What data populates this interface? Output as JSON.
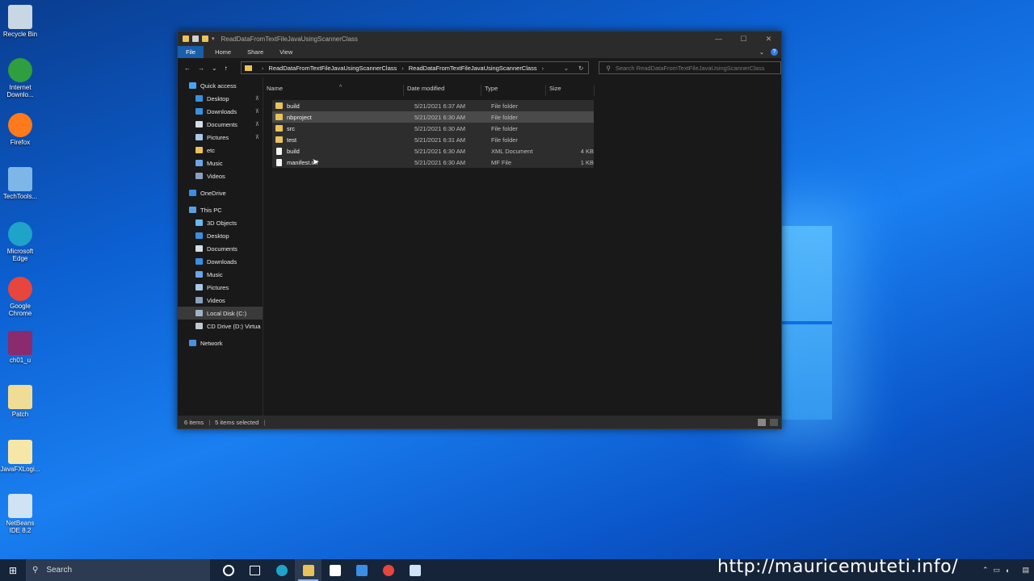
{
  "desktop": {
    "icons": [
      {
        "label": "Recycle Bin",
        "icon": "recycle-bin-icon",
        "color": "#c9d6e3"
      },
      {
        "label": "Internet Downlo...",
        "icon": "download-manager-icon",
        "color": "#2e9e3e"
      },
      {
        "label": "Firefox",
        "icon": "firefox-icon",
        "color": "#ff7a1a"
      },
      {
        "label": "TechTools...",
        "icon": "folder-shortcut-icon",
        "color": "#7fb6e8"
      },
      {
        "label": "Microsoft Edge",
        "icon": "edge-icon",
        "color": "#1fa3c8"
      },
      {
        "label": "Google Chrome",
        "icon": "chrome-icon",
        "color": "#e8453c"
      },
      {
        "label": "ch01_u",
        "icon": "winrar-icon",
        "color": "#8a2b6e"
      },
      {
        "label": "Patch",
        "icon": "folder-icon",
        "color": "#f1dc96"
      },
      {
        "label": "JavaFXLogi...",
        "icon": "java-file-icon",
        "color": "#f6e7a8"
      },
      {
        "label": "NetBeans IDE 8.2",
        "icon": "netbeans-icon",
        "color": "#cfe3f5"
      }
    ]
  },
  "window": {
    "title": "ReadDataFromTextFileJavaUsingScannerClass",
    "controls": {
      "minimize": "—",
      "maximize": "☐",
      "close": "✕"
    },
    "ribbon_tabs": [
      "File",
      "Home",
      "Share",
      "View"
    ],
    "help": "?",
    "address": {
      "segments": [
        "ReadDataFromTextFileJavaUsingScannerClass",
        "ReadDataFromTextFileJavaUsingScannerClass"
      ],
      "separator": "›"
    },
    "search_placeholder": "Search ReadDataFromTextFileJavaUsingScannerClass",
    "sidebar": [
      {
        "label": "Quick access",
        "icon": "star-icon",
        "color": "#4aa3f0",
        "indent": 14,
        "pinned": false
      },
      {
        "label": "Desktop",
        "icon": "desktop-icon",
        "color": "#3b8fe0",
        "indent": 22,
        "pinned": true
      },
      {
        "label": "Downloads",
        "icon": "download-arrow-icon",
        "color": "#3b8fe0",
        "indent": 22,
        "pinned": true
      },
      {
        "label": "Documents",
        "icon": "documents-icon",
        "color": "#d7dde6",
        "indent": 22,
        "pinned": true
      },
      {
        "label": "Pictures",
        "icon": "pictures-icon",
        "color": "#a9c8e8",
        "indent": 22,
        "pinned": true
      },
      {
        "label": "etc",
        "icon": "folder-icon",
        "color": "#e9c25c",
        "indent": 22,
        "pinned": false
      },
      {
        "label": "Music",
        "icon": "music-icon",
        "color": "#6aa6e8",
        "indent": 22,
        "pinned": false
      },
      {
        "label": "Videos",
        "icon": "videos-icon",
        "color": "#8aa0c0",
        "indent": 22,
        "pinned": false
      },
      {
        "label": "",
        "icon": "",
        "color": "",
        "indent": 0,
        "pinned": false,
        "spacer": true
      },
      {
        "label": "OneDrive",
        "icon": "onedrive-icon",
        "color": "#3a8ee6",
        "indent": 14,
        "pinned": false
      },
      {
        "label": "",
        "icon": "",
        "color": "",
        "indent": 0,
        "pinned": false,
        "spacer": true
      },
      {
        "label": "This PC",
        "icon": "computer-icon",
        "color": "#5aa0e0",
        "indent": 14,
        "pinned": false
      },
      {
        "label": "3D Objects",
        "icon": "3d-objects-icon",
        "color": "#6ab8f0",
        "indent": 22,
        "pinned": false
      },
      {
        "label": "Desktop",
        "icon": "desktop-icon",
        "color": "#3b8fe0",
        "indent": 22,
        "pinned": false
      },
      {
        "label": "Documents",
        "icon": "documents-icon",
        "color": "#d7dde6",
        "indent": 22,
        "pinned": false
      },
      {
        "label": "Downloads",
        "icon": "download-arrow-icon",
        "color": "#3b8fe0",
        "indent": 22,
        "pinned": false
      },
      {
        "label": "Music",
        "icon": "music-icon",
        "color": "#6aa6e8",
        "indent": 22,
        "pinned": false
      },
      {
        "label": "Pictures",
        "icon": "pictures-icon",
        "color": "#a9c8e8",
        "indent": 22,
        "pinned": false
      },
      {
        "label": "Videos",
        "icon": "videos-icon",
        "color": "#8aa0c0",
        "indent": 22,
        "pinned": false
      },
      {
        "label": "Local Disk (C:)",
        "icon": "disk-icon",
        "color": "#9fb4c8",
        "indent": 22,
        "pinned": false,
        "selected": true
      },
      {
        "label": "CD Drive (D:) Virtua",
        "icon": "cd-drive-icon",
        "color": "#c0c8d0",
        "indent": 22,
        "pinned": false
      },
      {
        "label": "",
        "icon": "",
        "color": "",
        "indent": 0,
        "pinned": false,
        "spacer": true
      },
      {
        "label": "Network",
        "icon": "network-icon",
        "color": "#4a90e2",
        "indent": 14,
        "pinned": false
      }
    ],
    "columns": [
      "Name",
      "Date modified",
      "Type",
      "Size"
    ],
    "files": [
      {
        "name": "build",
        "date": "5/21/2021 6:37 AM",
        "type": "File folder",
        "size": "",
        "kind": "folder",
        "state": "selected"
      },
      {
        "name": "nbproject",
        "date": "5/21/2021 6:30 AM",
        "type": "File folder",
        "size": "",
        "kind": "folder",
        "state": "hover"
      },
      {
        "name": "src",
        "date": "5/21/2021 6:30 AM",
        "type": "File folder",
        "size": "",
        "kind": "folder",
        "state": "selected"
      },
      {
        "name": "test",
        "date": "5/21/2021 6:31 AM",
        "type": "File folder",
        "size": "",
        "kind": "folder",
        "state": "selected"
      },
      {
        "name": "build",
        "date": "5/21/2021 6:30 AM",
        "type": "XML Document",
        "size": "4 KB",
        "kind": "doc",
        "state": "selected"
      },
      {
        "name": "manifest.mf",
        "date": "5/21/2021 6:30 AM",
        "type": "MF File",
        "size": "1 KB",
        "kind": "doc",
        "state": "selected"
      }
    ],
    "status": {
      "items": "6 items",
      "selected": "5 items selected"
    }
  },
  "taskbar": {
    "search_label": "Search",
    "apps": [
      {
        "icon": "cortana-icon",
        "color": "#ffffff"
      },
      {
        "icon": "task-view-icon",
        "color": "#ffffff"
      },
      {
        "icon": "edge-icon",
        "color": "#1fa3c8"
      },
      {
        "icon": "file-explorer-icon",
        "color": "#e9c25c",
        "active": true
      },
      {
        "icon": "store-icon",
        "color": "#ffffff"
      },
      {
        "icon": "mail-icon",
        "color": "#3a8ee6"
      },
      {
        "icon": "chrome-icon",
        "color": "#e8453c"
      },
      {
        "icon": "netbeans-icon",
        "color": "#cfe3f5"
      }
    ],
    "watermark": "http://mauricemuteti.info/"
  }
}
